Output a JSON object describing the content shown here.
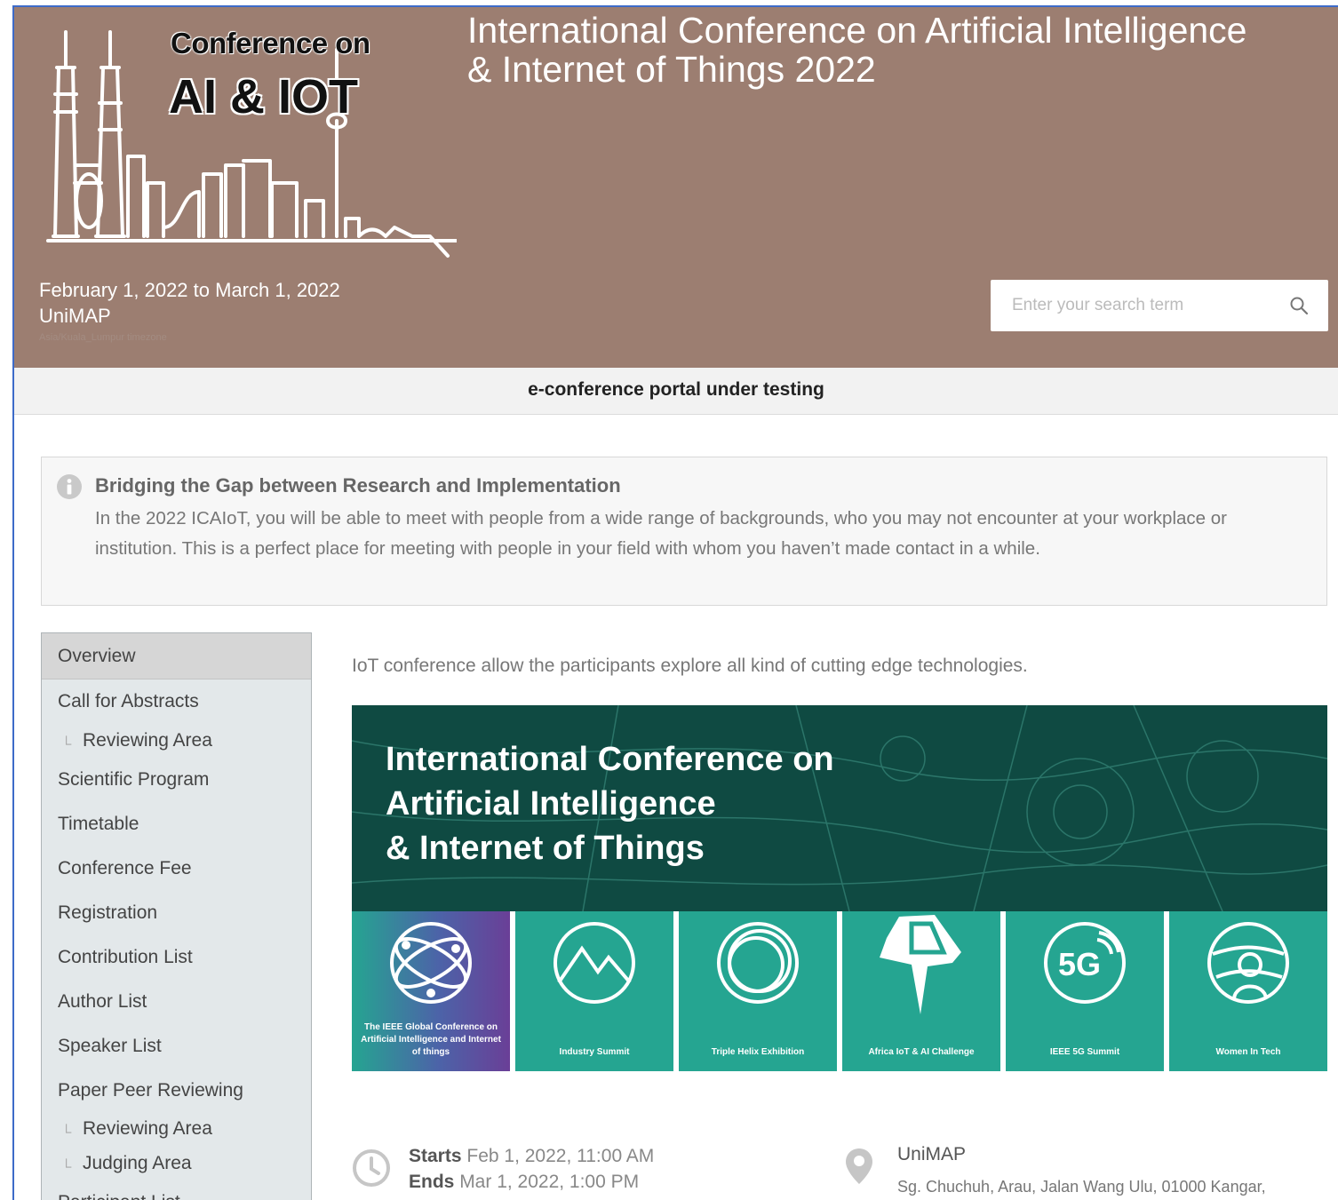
{
  "header": {
    "logo_line1": "Conference on",
    "logo_line2": "AI & IOT",
    "title_line1": "International Conference on Artificial Intelligence",
    "title_line2": "& Internet of Things 2022",
    "dates": "February 1, 2022 to March 1, 2022",
    "venue": "UniMAP",
    "timezone": "Asia/Kuala_Lumpur timezone",
    "bg_color": "#9c7e71"
  },
  "search": {
    "placeholder": "Enter your search term"
  },
  "notice": {
    "text": "e-conference portal under testing"
  },
  "info": {
    "title": "Bridging the Gap between Research and Implementation",
    "body": "In the 2022 ICAIoT, you will be able to meet with people from a wide range of backgrounds, who you may not encounter at your workplace or institution. This is a perfect place for meeting with people in your field with whom you haven’t made contact in a while."
  },
  "sidebar": {
    "items": [
      {
        "label": "Overview"
      },
      {
        "label": "Call for Abstracts"
      },
      {
        "label": "Reviewing Area"
      },
      {
        "label": "Scientific Program"
      },
      {
        "label": "Timetable"
      },
      {
        "label": "Conference Fee"
      },
      {
        "label": "Registration"
      },
      {
        "label": "Contribution List"
      },
      {
        "label": "Author List"
      },
      {
        "label": "Speaker List"
      },
      {
        "label": "Paper Peer Reviewing"
      },
      {
        "label": "Reviewing Area"
      },
      {
        "label": "Judging Area"
      },
      {
        "label": "Participant List"
      }
    ]
  },
  "main": {
    "intro": "IoT conference allow the participants explore all kind of cutting edge technologies.",
    "banner": {
      "title_line1": "International Conference on",
      "title_line2": "Artificial Intelligence",
      "title_line3": "& Internet of Things",
      "tiles": [
        {
          "icon": "globe-network-icon",
          "label": "The IEEE Global Conference on Artificial Intelligence and Internet of things"
        },
        {
          "icon": "mountains-icon",
          "label": "Industry Summit"
        },
        {
          "icon": "rings-icon",
          "label": "Triple Helix Exhibition"
        },
        {
          "icon": "africa-map-icon",
          "label": "Africa IoT & AI Challenge"
        },
        {
          "icon": "5g-icon",
          "label": "IEEE 5G Summit"
        },
        {
          "icon": "woman-globe-icon",
          "label": "Women In Tech"
        }
      ]
    },
    "event": {
      "starts_label": "Starts",
      "starts_value": "Feb 1, 2022, 11:00 AM",
      "ends_label": "Ends",
      "ends_value": "Mar 1, 2022, 1:00 PM",
      "venue_name": "UniMAP",
      "venue_address": "Sg. Chuchuh, Arau, Jalan Wang Ulu, 01000 Kangar,"
    }
  }
}
